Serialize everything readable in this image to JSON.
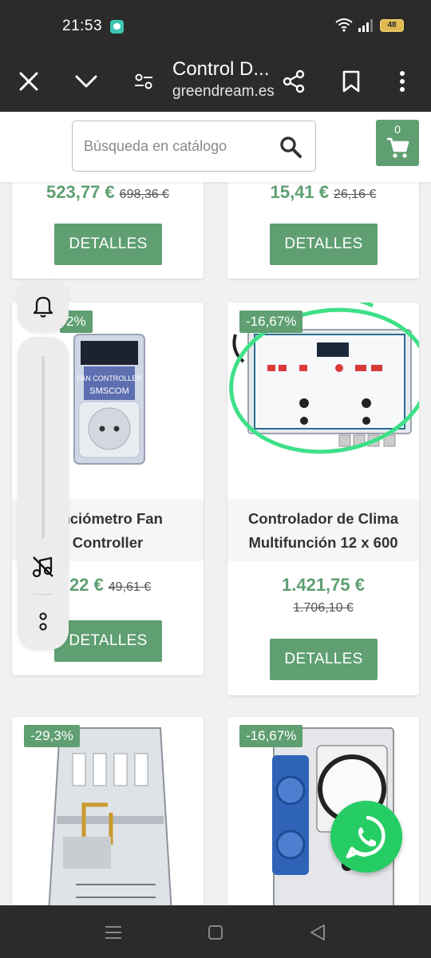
{
  "status_bar": {
    "time": "21:53",
    "battery": "48"
  },
  "toolbar": {
    "title": "Control D...",
    "url": "greendream.es"
  },
  "search": {
    "placeholder": "Búsqueda en catálogo"
  },
  "cart": {
    "count": "0"
  },
  "colors": {
    "brand_green": "#5f9f72",
    "highlight_circle": "#3ee087",
    "whatsapp": "#26cc64"
  },
  "products": [
    {
      "price": "523,77 €",
      "old_price": "698,36 €",
      "button": "DETALLES"
    },
    {
      "price": "15,41 €",
      "old_price": "26,16 €",
      "button": "DETALLES"
    },
    {
      "discount": "2%",
      "name_line1": "enciómetro Fan",
      "name_line2": "Controller",
      "price": ",22 €",
      "old_price": "49,61 €",
      "button": "DETALLES"
    },
    {
      "discount": "-16,67%",
      "name_line1": "Controlador de Clima",
      "name_line2": "Multifunción 12 x 600",
      "price": "1.421,75 €",
      "old_price": "1.706,10 €",
      "button": "DETALLES"
    },
    {
      "discount": "-29,3%"
    },
    {
      "discount": "-16,67%"
    }
  ],
  "icons": {
    "close": "close-icon",
    "collapse": "chevron-down-icon",
    "settings": "tune-icon",
    "share": "share-icon",
    "bookmark": "bookmark-icon",
    "menu": "more-vert-icon",
    "search": "search-icon",
    "cart": "cart-icon",
    "bell": "bell-icon",
    "music_off": "music-off-icon",
    "more": "more-icon",
    "whatsapp": "whatsapp-icon"
  }
}
